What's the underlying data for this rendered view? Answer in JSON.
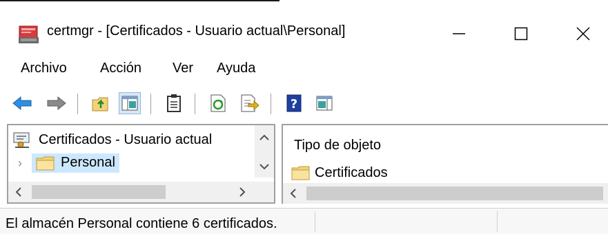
{
  "window": {
    "title": "certmgr - [Certificados - Usuario actual\\Personal]",
    "controls": {
      "minimize": "minimize",
      "maximize": "maximize",
      "close": "close"
    }
  },
  "menu": {
    "items": [
      {
        "label": "Archivo"
      },
      {
        "label": "Acción"
      },
      {
        "label": "Ver"
      },
      {
        "label": "Ayuda"
      }
    ]
  },
  "toolbar": {
    "buttons": [
      {
        "icon": "back-arrow-icon"
      },
      {
        "icon": "forward-arrow-icon"
      },
      {
        "icon": "up-folder-icon"
      },
      {
        "icon": "show-hide-console-tree-icon",
        "pressed": true
      },
      {
        "icon": "clipboard-icon"
      },
      {
        "icon": "refresh-icon"
      },
      {
        "icon": "export-list-icon"
      },
      {
        "icon": "help-icon"
      },
      {
        "icon": "action-pane-icon"
      }
    ]
  },
  "tree": {
    "root_label": "Certificados - Usuario actual",
    "selected_label": "Personal"
  },
  "list": {
    "column_header": "Tipo de objeto",
    "items": [
      {
        "label": "Certificados"
      }
    ]
  },
  "status": {
    "text": "El almacén Personal contiene 6 certificados."
  },
  "colors": {
    "selection": "#cce8ff",
    "folder": "#f3d37a",
    "arrow_blue": "#2d8fe0"
  }
}
